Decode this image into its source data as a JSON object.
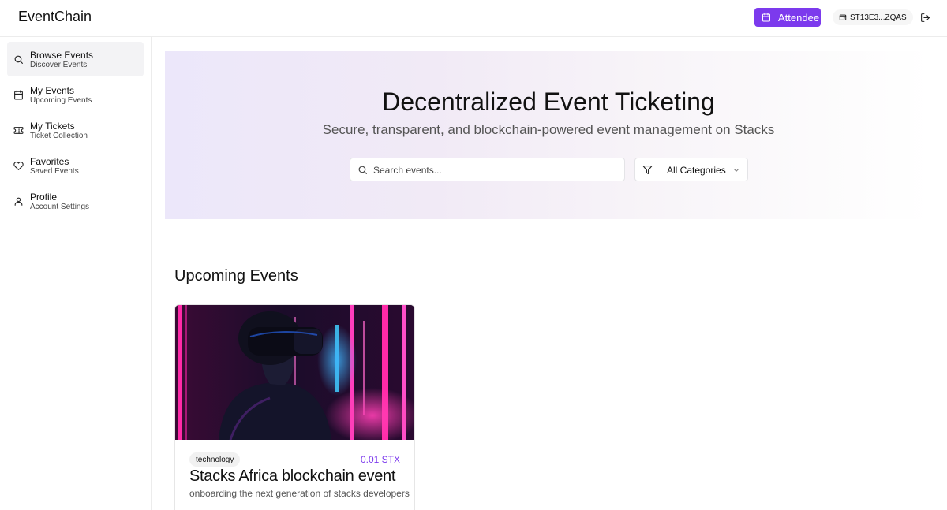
{
  "app": {
    "title": "EventChain"
  },
  "header": {
    "role_button_label": "Attendee",
    "wallet_address": "ST13E3...ZQAS",
    "icons": {
      "role": "calendar-icon",
      "wallet": "wallet-icon",
      "logout": "logout-icon"
    }
  },
  "sidebar": {
    "items": [
      {
        "label": "Browse Events",
        "sublabel": "Discover Events",
        "icon": "search-icon",
        "active": true
      },
      {
        "label": "My Events",
        "sublabel": "Upcoming Events",
        "icon": "calendar-icon",
        "active": false
      },
      {
        "label": "My Tickets",
        "sublabel": "Ticket Collection",
        "icon": "ticket-icon",
        "active": false
      },
      {
        "label": "Favorites",
        "sublabel": "Saved Events",
        "icon": "heart-icon",
        "active": false
      },
      {
        "label": "Profile",
        "sublabel": "Account Settings",
        "icon": "user-icon",
        "active": false
      }
    ]
  },
  "hero": {
    "title": "Decentralized Event Ticketing",
    "subtitle": "Secure, transparent, and blockchain-powered event management on Stacks",
    "search": {
      "placeholder": "Search events...",
      "value": ""
    },
    "category_select": {
      "selected": "All Categories"
    }
  },
  "main": {
    "section_title": "Upcoming Events",
    "events": [
      {
        "category": "technology",
        "price": "0.01 STX",
        "title": "Stacks Africa blockchain event",
        "description": "onboarding the next generation of stacks developers"
      }
    ]
  },
  "colors": {
    "accent": "#7c3aed",
    "hero_gradient_start": "#ece7fa",
    "sidebar_active_bg": "#f3f3f5"
  }
}
